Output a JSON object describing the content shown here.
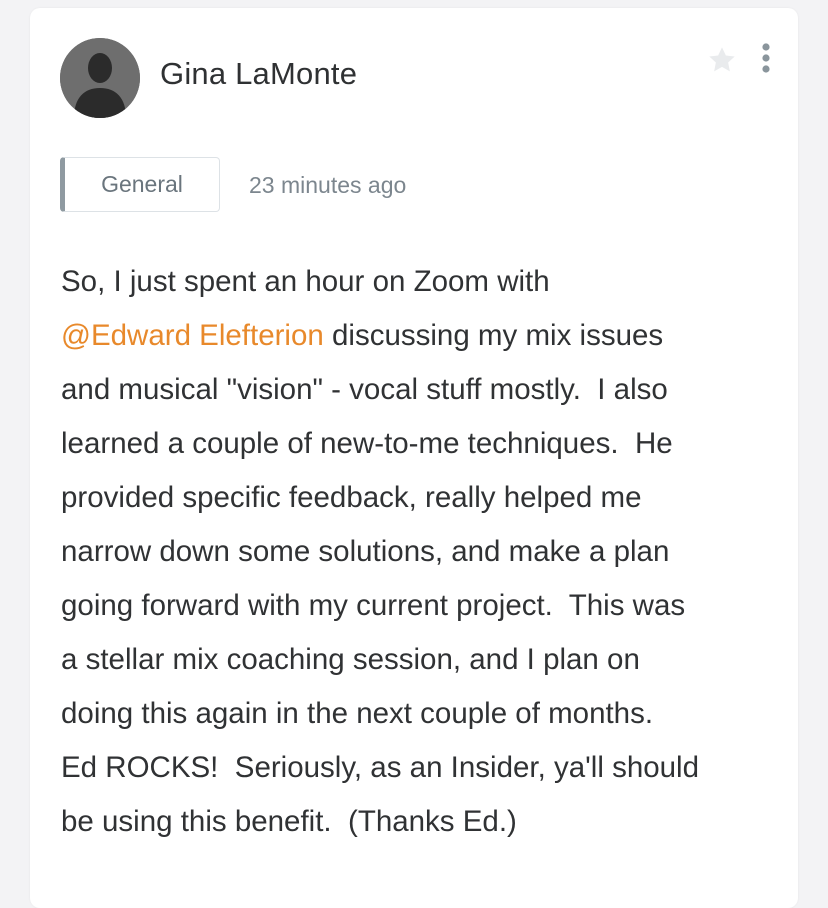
{
  "post": {
    "author": {
      "name": "Gina LaMonte"
    },
    "category": "General",
    "timestamp": "23 minutes ago",
    "body": {
      "line1": "So, I just spent an hour on Zoom with",
      "mention": "@Edward Elefterion",
      "line2_rest": " discussing my mix issues",
      "line3": "and musical \"vision\" - vocal stuff mostly.  I also",
      "line4": "learned a couple of new-to-me techniques.  He",
      "line5": "provided specific feedback, really helped me",
      "line6": "narrow down some solutions, and make a plan",
      "line7": "going forward with my current project.  This was",
      "line8": "a stellar mix coaching session, and I plan on",
      "line9": "doing this again in the next couple of months.",
      "line10": "Ed ROCKS!  Seriously, as an Insider, ya'll should",
      "line11": "be using this benefit.  (Thanks Ed.)"
    },
    "icons": {
      "star": "star-icon",
      "more": "more-vertical-icon",
      "avatar": "default-user-avatar"
    },
    "colors": {
      "mention": "#e8892b",
      "text": "#303234",
      "badge_accent": "#8f9aa1"
    }
  }
}
